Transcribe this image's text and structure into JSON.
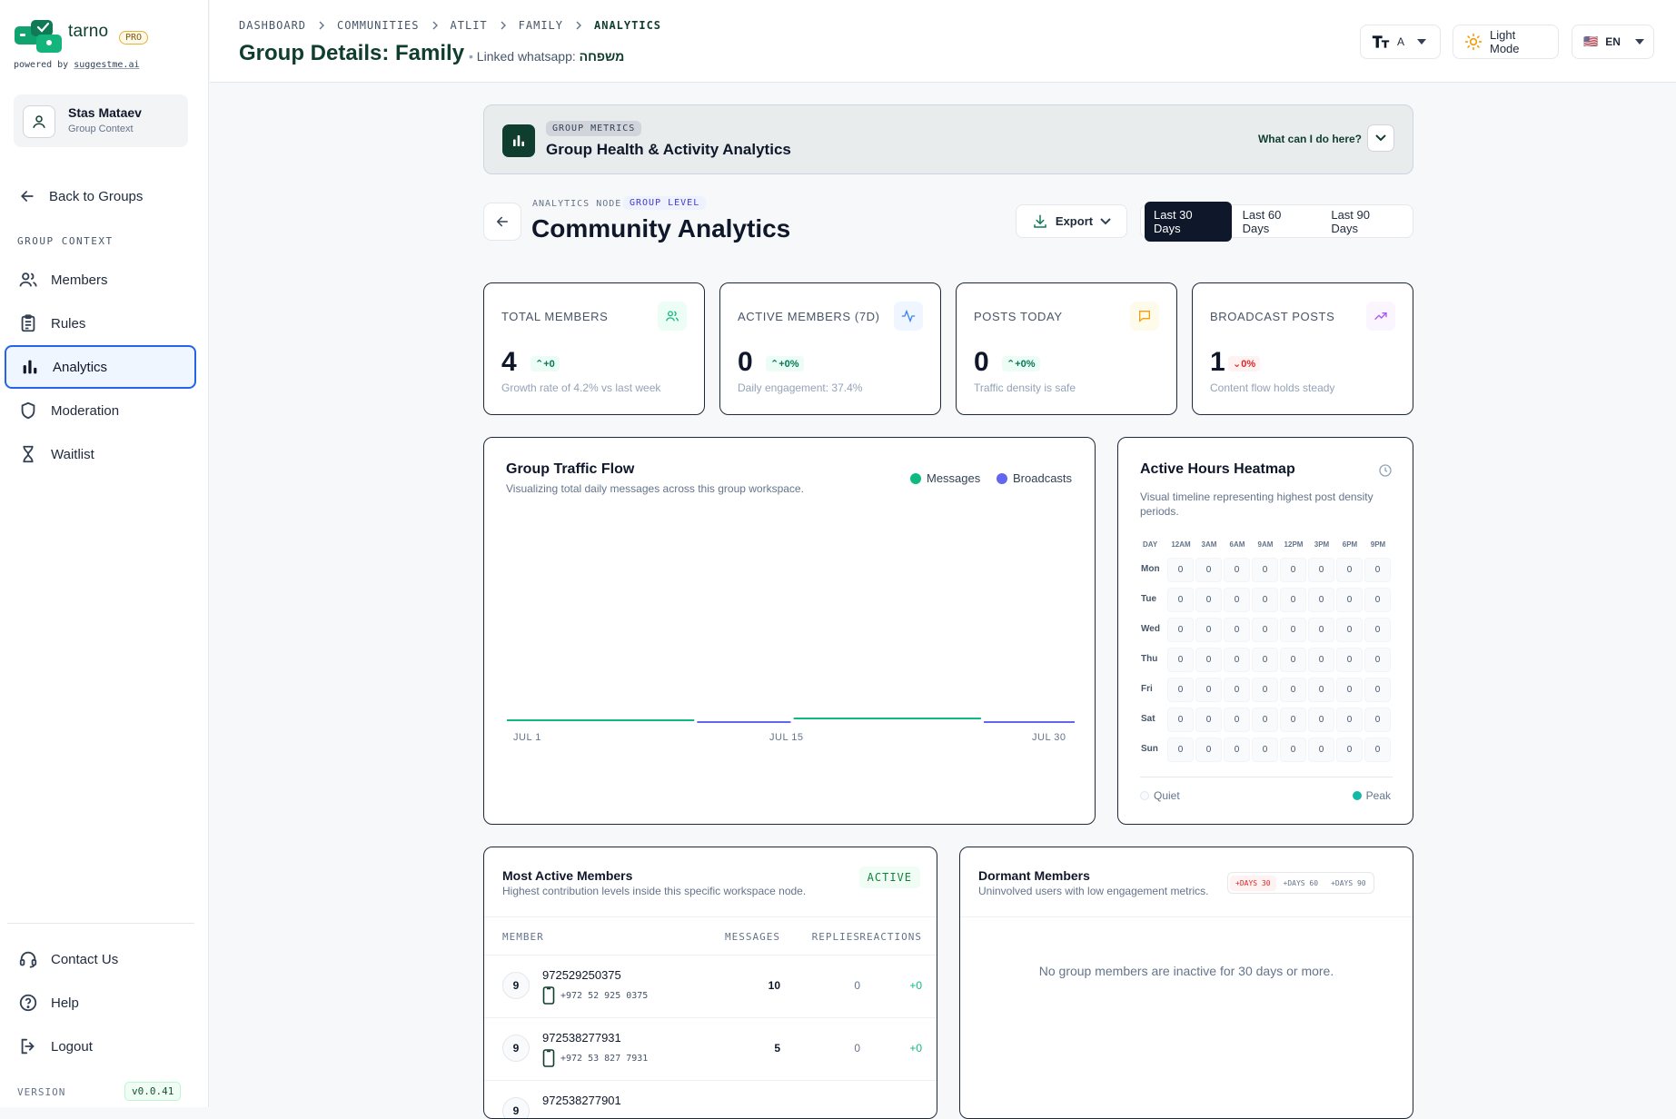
{
  "sidebar": {
    "brand": "tarno",
    "pro_badge": "PRO",
    "powered_prefix": "powered by",
    "powered_link": "suggestme.ai",
    "user": {
      "name": "Stas Mataev",
      "role": "Group Context"
    },
    "back_label": "Back to Groups",
    "section_label": "GROUP CONTEXT",
    "nav": [
      {
        "label": "Members",
        "icon": "users-icon",
        "active": false
      },
      {
        "label": "Rules",
        "icon": "clipboard-icon",
        "active": false
      },
      {
        "label": "Analytics",
        "icon": "bar-chart-icon",
        "active": true
      },
      {
        "label": "Moderation",
        "icon": "shield-icon",
        "active": false
      },
      {
        "label": "Waitlist",
        "icon": "hourglass-icon",
        "active": false
      }
    ],
    "footer": [
      {
        "label": "Contact Us",
        "icon": "headset-icon"
      },
      {
        "label": "Help",
        "icon": "help-circle-icon"
      },
      {
        "label": "Logout",
        "icon": "logout-icon"
      }
    ],
    "version_label": "VERSION",
    "version": "v0.0.41"
  },
  "header": {
    "breadcrumbs": [
      "DASHBOARD",
      "COMMUNITIES",
      "ATLIT",
      "FAMILY",
      "ANALYTICS"
    ],
    "title": "Group Details: Family",
    "linked_label": "Linked whatsapp:",
    "linked_value": "משפחה",
    "font_size_label": "A",
    "theme_label": "Light Mode",
    "language": "EN",
    "language_flag": "🇺🇸"
  },
  "banner": {
    "tag": "GROUP METRICS",
    "title": "Group Health & Activity Analytics",
    "help": "What can I do here?"
  },
  "analytics": {
    "node_label": "ANALYTICS NODE",
    "level_badge": "GROUP LEVEL",
    "title": "Community Analytics",
    "export_label": "Export",
    "ranges": [
      "Last 30 Days",
      "Last 60 Days",
      "Last 90 Days"
    ],
    "selected_range": "Last 30 Days"
  },
  "stats": [
    {
      "label": "TOTAL MEMBERS",
      "value": "4",
      "delta": "+0",
      "dir": "up",
      "sub": "Growth rate of 4.2% vs last week",
      "icon": "users-icon",
      "color": "#10b981",
      "bg": "#ecfdf5"
    },
    {
      "label": "ACTIVE MEMBERS (7D)",
      "value": "0",
      "delta": "+0%",
      "dir": "up",
      "sub": "Daily engagement: 37.4%",
      "icon": "activity-icon",
      "color": "#3b82f6",
      "bg": "#eff6ff"
    },
    {
      "label": "POSTS TODAY",
      "value": "0",
      "delta": "+0%",
      "dir": "up",
      "sub": "Traffic density is safe",
      "icon": "message-icon",
      "color": "#f59e0b",
      "bg": "#fffbeb"
    },
    {
      "label": "BROADCAST POSTS",
      "value": "1",
      "delta": "0%",
      "dir": "down",
      "sub": "Content flow holds steady",
      "icon": "trending-up-icon",
      "color": "#a855f7",
      "bg": "#faf5ff"
    }
  ],
  "traffic": {
    "title": "Group Traffic Flow",
    "subtitle": "Visualizing total daily messages across this group workspace.",
    "legend": [
      {
        "name": "Messages",
        "color": "#10b981"
      },
      {
        "name": "Broadcasts",
        "color": "#6366f1"
      }
    ],
    "x_labels": [
      "JUL 1",
      "JUL 15",
      "JUL 30"
    ]
  },
  "chart_data": {
    "type": "line",
    "title": "Group Traffic Flow",
    "x": [
      "JUL 1",
      "JUL 15",
      "JUL 30"
    ],
    "series": [
      {
        "name": "Messages",
        "values": [
          0,
          0,
          0
        ]
      },
      {
        "name": "Broadcasts",
        "values": [
          0,
          0,
          0
        ]
      }
    ]
  },
  "heatmap": {
    "title": "Active Hours Heatmap",
    "subtitle": "Visual timeline representing highest post density periods.",
    "day_header": "DAY",
    "hours": [
      "12 AM",
      "3 AM",
      "6 AM",
      "9 AM",
      "12 PM",
      "3 PM",
      "6 PM",
      "9 PM"
    ],
    "days": [
      "Mon",
      "Tue",
      "Wed",
      "Thu",
      "Fri",
      "Sat",
      "Sun"
    ],
    "values": [
      [
        0,
        0,
        0,
        0,
        0,
        0,
        0,
        0
      ],
      [
        0,
        0,
        0,
        0,
        0,
        0,
        0,
        0
      ],
      [
        0,
        0,
        0,
        0,
        0,
        0,
        0,
        0
      ],
      [
        0,
        0,
        0,
        0,
        0,
        0,
        0,
        0
      ],
      [
        0,
        0,
        0,
        0,
        0,
        0,
        0,
        0
      ],
      [
        0,
        0,
        0,
        0,
        0,
        0,
        0,
        0
      ],
      [
        0,
        0,
        0,
        0,
        0,
        0,
        0,
        0
      ]
    ],
    "quiet_label": "Quiet",
    "peak_label": "Peak"
  },
  "active_members": {
    "title": "Most Active Members",
    "subtitle": "Highest contribution levels inside this specific workspace node.",
    "badge": "ACTIVE",
    "columns": [
      "MEMBER",
      "MESSAGES",
      "REPLIES",
      "REACTIONS"
    ],
    "rows": [
      {
        "rank": "9",
        "name": "972529250375",
        "phone": "+972 52 925 0375",
        "messages": "10",
        "replies": "0",
        "reactions": "+0"
      },
      {
        "rank": "9",
        "name": "972538277931",
        "phone": "+972 53 827 7931",
        "messages": "5",
        "replies": "0",
        "reactions": "+0"
      },
      {
        "rank": "9",
        "name": "972538277901",
        "phone": "",
        "messages": "",
        "replies": "",
        "reactions": ""
      }
    ]
  },
  "dormant": {
    "title": "Dormant Members",
    "subtitle": "Uninvolved users with low engagement metrics.",
    "filters": [
      "+DAYS 30",
      "+DAYS 60",
      "+DAYS 90"
    ],
    "selected_filter": "+DAYS 30",
    "empty": "No group members are inactive for 30 days or more."
  }
}
